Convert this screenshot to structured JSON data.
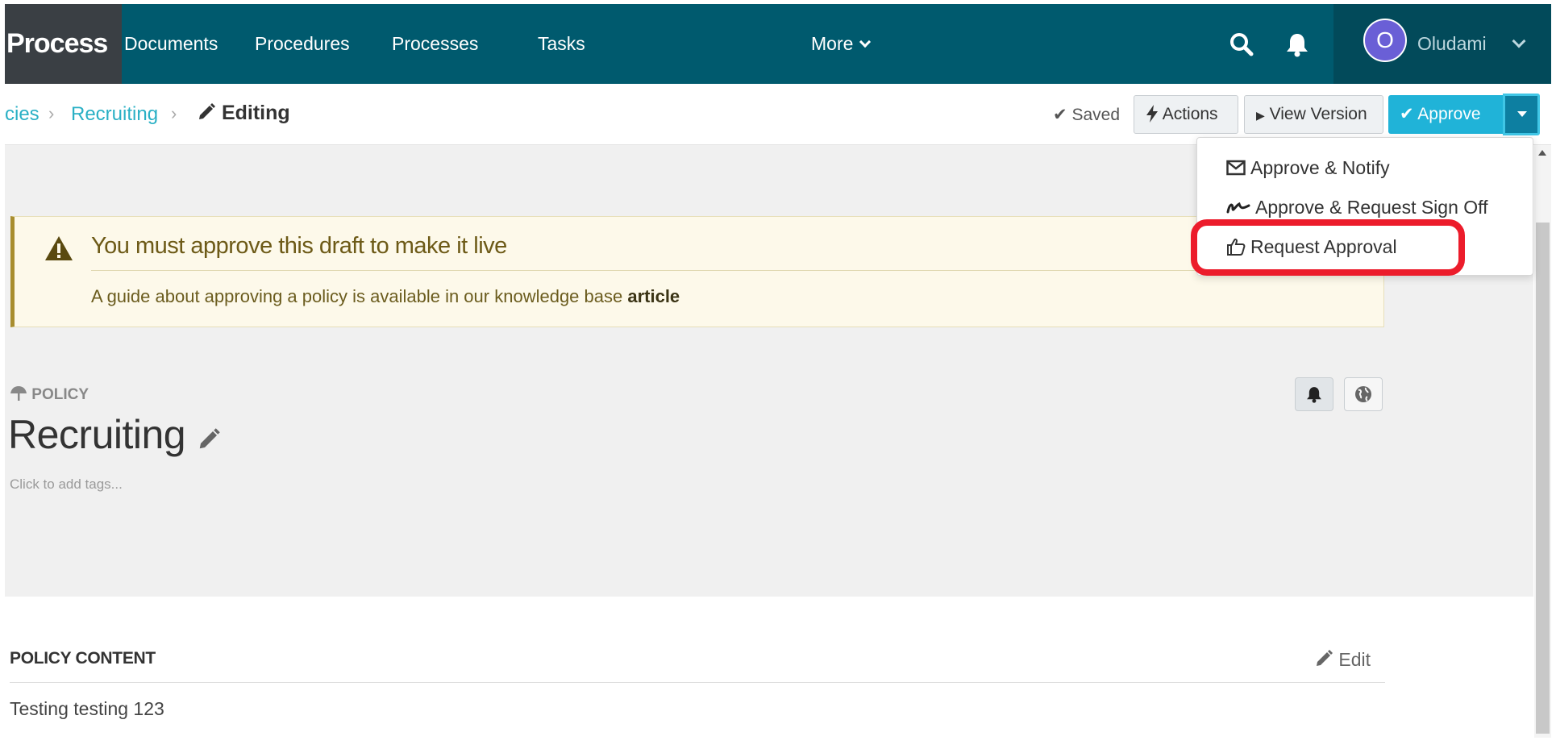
{
  "nav": {
    "brand": "Process",
    "items": [
      "Documents",
      "Procedures",
      "Processes",
      "Tasks",
      "More"
    ],
    "search_icon": "search-icon",
    "bell_icon": "bell-icon",
    "user_initial": "O",
    "user_name": "Oludami"
  },
  "breadcrumb": {
    "items": [
      "cies",
      "Recruiting"
    ],
    "current": "Editing"
  },
  "toolbar": {
    "saved_label": "Saved",
    "actions_label": "Actions",
    "view_version_label": "View Version",
    "approve_label": "Approve"
  },
  "dropdown": {
    "items": [
      "Approve & Notify",
      "Approve & Request Sign Off",
      "Request Approval"
    ],
    "highlighted": "Request Approval"
  },
  "alert": {
    "title": "You must approve this draft to make it live",
    "text": "A guide about approving a policy is available in our knowledge base ",
    "link": "article"
  },
  "policy": {
    "label": "POLICY",
    "title": "Recruiting",
    "tags_placeholder": "Click to add tags..."
  },
  "content": {
    "section_title": "POLICY CONTENT",
    "edit_label": "Edit",
    "body": "Testing testing 123"
  },
  "colors": {
    "nav_bg": "#005a6e",
    "brand_bg": "#3a3f44",
    "link": "#2ab0c5",
    "approve": "#20b3d8",
    "highlight": "#ec1c2b"
  }
}
